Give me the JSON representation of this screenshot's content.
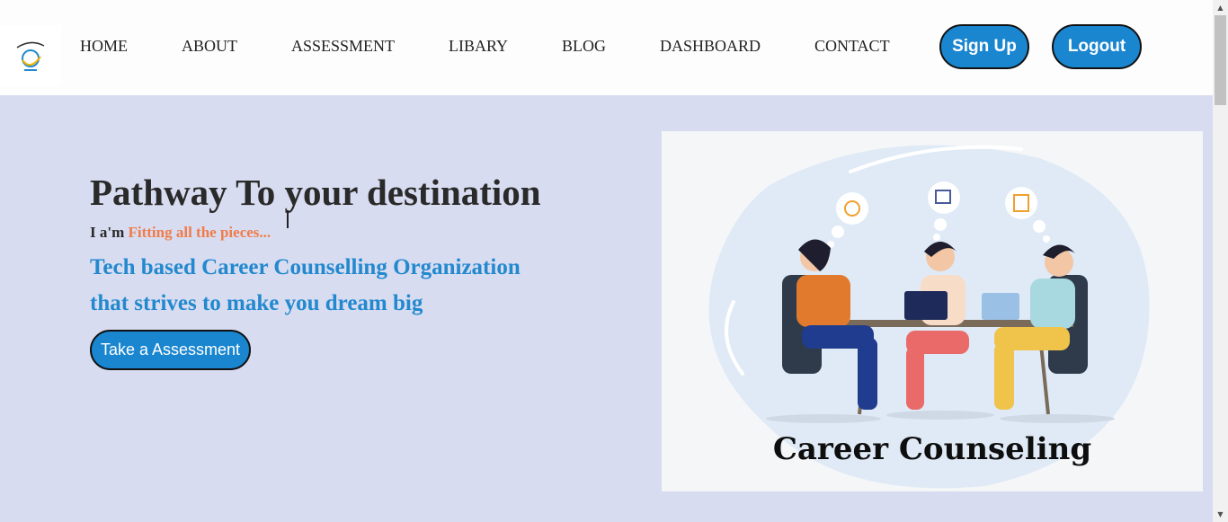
{
  "nav": {
    "logo_alt": "TalentSync",
    "links": [
      "HOME",
      "ABOUT",
      "ASSESSMENT",
      "LIBARY",
      "BLOG",
      "DASHBOARD",
      "CONTACT"
    ],
    "signup_label": "Sign Up",
    "logout_label": "Logout"
  },
  "hero": {
    "title": "Pathway To your destination",
    "typed_prefix": "I a'm ",
    "typed_text": "Fitting all the pieces...",
    "tagline_line1": "Tech based Career Counselling Organization",
    "tagline_line2": "that strives to make you dream big",
    "cta_label": "Take a Assessment",
    "illustration_caption": "Career Counseling"
  },
  "colors": {
    "accent": "#1a86d0",
    "hero_bg": "#d8dcf0",
    "tagline": "#2389cf",
    "typed": "#f07c4a"
  }
}
